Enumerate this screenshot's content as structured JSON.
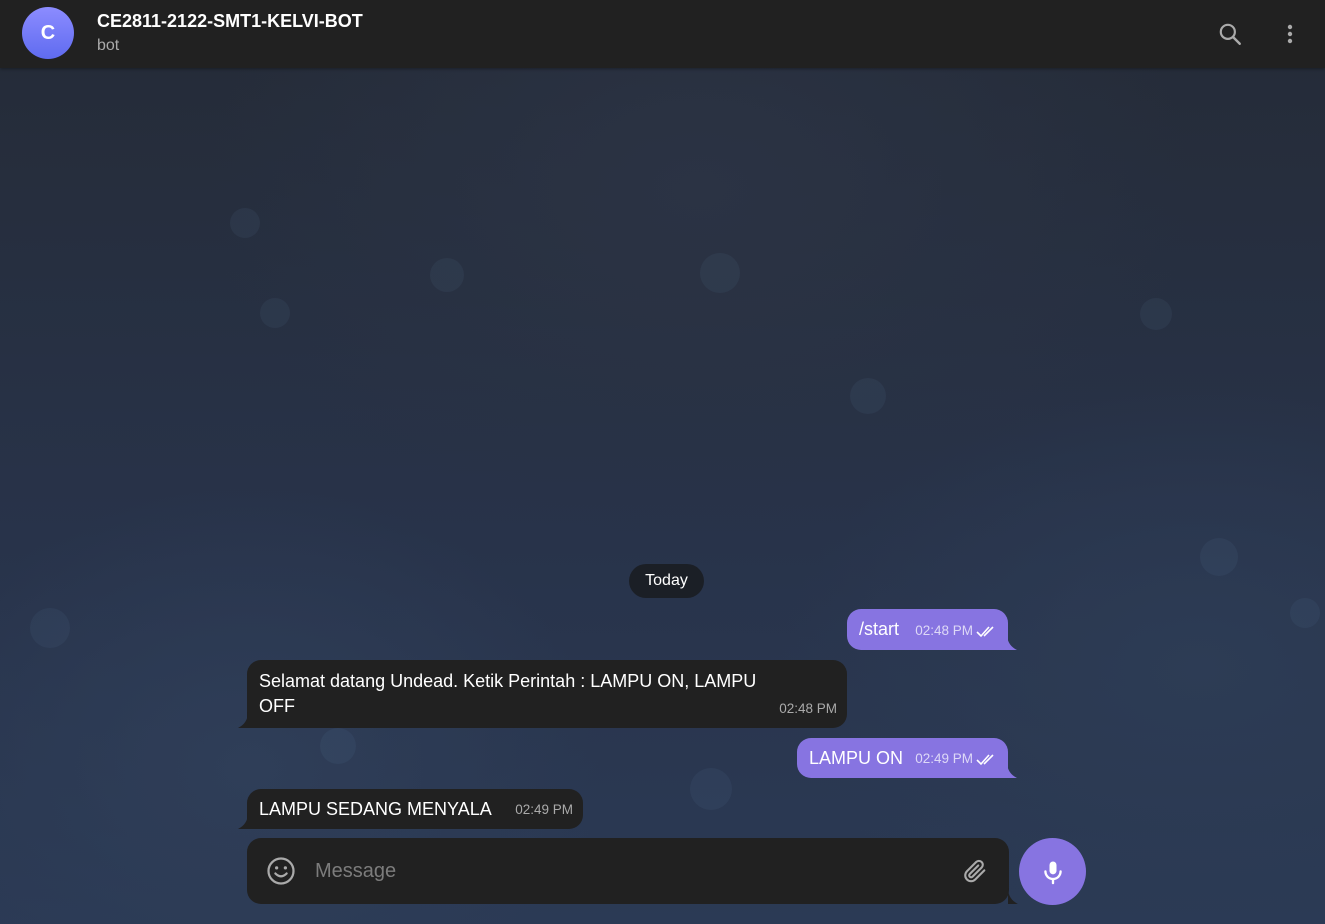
{
  "header": {
    "avatar_letter": "C",
    "title": "CE2811-2122-SMT1-KELVI-BOT",
    "subtitle": "bot",
    "search_icon": "search-icon",
    "menu_icon": "more-vertical-icon"
  },
  "chat": {
    "date_label": "Today",
    "messages": [
      {
        "direction": "outgoing",
        "text": "/start",
        "time": "02:48 PM",
        "status": "read"
      },
      {
        "direction": "incoming",
        "text_line1": "Selamat datang Undead. Ketik Perintah : LAMPU ON, LAMPU",
        "text_line2": "OFF",
        "time": "02:48 PM"
      },
      {
        "direction": "outgoing",
        "text": "LAMPU ON",
        "time": "02:49 PM",
        "status": "read"
      },
      {
        "direction": "incoming",
        "text": "LAMPU SEDANG MENYALA",
        "time": "02:49 PM"
      }
    ]
  },
  "composer": {
    "placeholder": "Message",
    "emoji_icon": "smile-icon",
    "attach_icon": "paperclip-icon",
    "send_icon": "microphone-icon"
  },
  "colors": {
    "accent": "#8774e1",
    "header_bg": "#212121",
    "incoming_bubble": "#212121",
    "outgoing_bubble": "#8774e1"
  }
}
